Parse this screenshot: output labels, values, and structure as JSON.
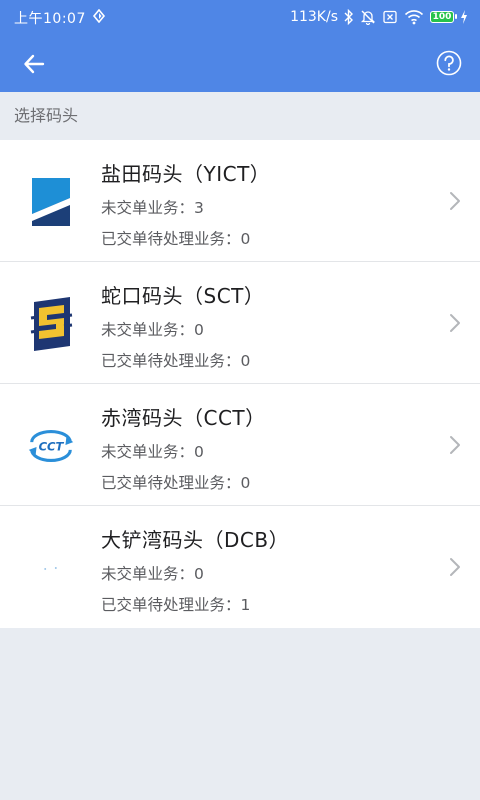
{
  "status_bar": {
    "time": "上午10:07",
    "net_speed": "113K/s",
    "battery": "100"
  },
  "section_title": "选择码头",
  "terminals": [
    {
      "name": "盐田码头（YICT）",
      "unsubmitted_label": "未交单业务：",
      "unsubmitted_count": "3",
      "pending_label": "已交单待处理业务：",
      "pending_count": "0",
      "logo_icon": "yict-logo-icon"
    },
    {
      "name": "蛇口码头（SCT）",
      "unsubmitted_label": "未交单业务：",
      "unsubmitted_count": "0",
      "pending_label": "已交单待处理业务：",
      "pending_count": "0",
      "logo_icon": "sct-logo-icon"
    },
    {
      "name": "赤湾码头（CCT）",
      "unsubmitted_label": "未交单业务：",
      "unsubmitted_count": "0",
      "pending_label": "已交单待处理业务：",
      "pending_count": "0",
      "logo_icon": "cct-logo-icon"
    },
    {
      "name": "大铲湾码头（DCB）",
      "unsubmitted_label": "未交单业务：",
      "unsubmitted_count": "0",
      "pending_label": "已交单待处理业务：",
      "pending_count": "1",
      "logo_icon": "dcb-logo-icon"
    }
  ],
  "cct_logo_text": "CCT",
  "colors": {
    "header": "#4f86e6",
    "background": "#e8ecf2",
    "card": "#ffffff",
    "text_primary": "#1f1f21",
    "text_secondary": "#5b5c60"
  }
}
